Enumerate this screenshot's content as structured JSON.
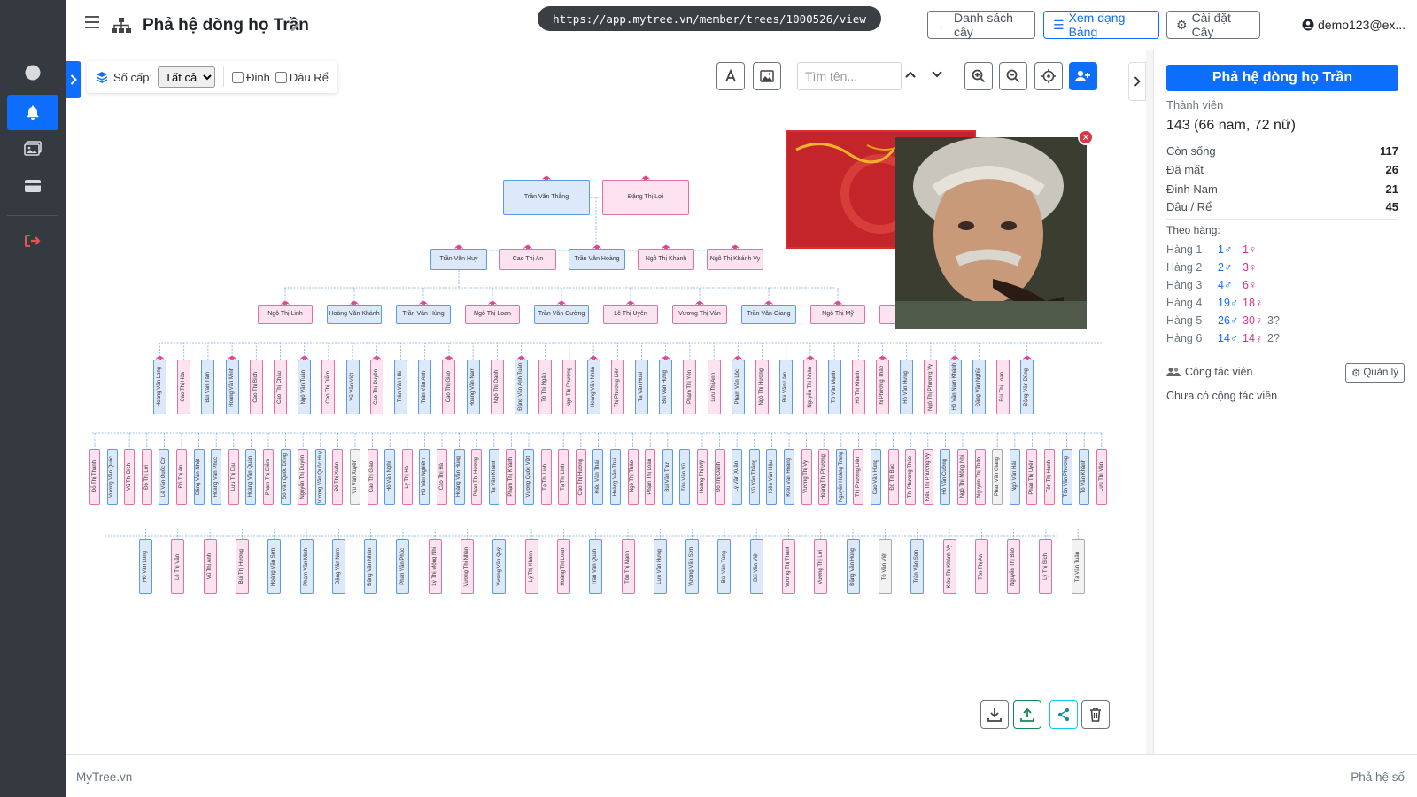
{
  "header": {
    "title": "Phả hệ dòng họ Trần",
    "url": "https://app.mytree.vn/member/trees/1000526/view",
    "btn_list": "Danh sách cây",
    "btn_table": "Xem dạng Bảng",
    "btn_settings": "Cài đặt Cây",
    "user": "demo123@ex..."
  },
  "toolbar": {
    "level_label": "Số cấp:",
    "level_value": "Tất cả",
    "chk_dinh": "Đinh",
    "chk_dau_re": "Dâu Rể",
    "search_placeholder": "Tìm tên..."
  },
  "icons": {
    "sidebar": [
      "circle-icon",
      "bell-icon",
      "images-icon",
      "card-icon",
      "logout-icon"
    ],
    "tools": [
      "font-icon",
      "image-icon",
      "zoom-in-icon",
      "zoom-out-icon",
      "locate-icon",
      "add-user-icon"
    ],
    "actions": [
      "download-icon",
      "upload-icon",
      "share-icon",
      "trash-icon"
    ]
  },
  "colors": {
    "primary": "#0d6efd",
    "male": "#dbe9fb",
    "female": "#fde3ef",
    "sidebar": "#343a40",
    "danger": "#dc3545"
  },
  "tree": {
    "gen1": [
      {
        "name": "Trần Văn Thắng",
        "g": "m"
      },
      {
        "name": "Đặng Thị Lợi",
        "g": "f"
      }
    ],
    "gen2": [
      {
        "name": "Trần Văn Huy",
        "g": "m"
      },
      {
        "name": "Cao Thị An",
        "g": "f"
      },
      {
        "name": "Trần Văn Hoàng",
        "g": "m"
      },
      {
        "name": "Ngô Thị Khánh",
        "g": "f"
      },
      {
        "name": "Ngô Thị Khánh Vy",
        "g": "f"
      }
    ],
    "gen3": [
      {
        "name": "Ngô Thị Linh",
        "g": "f"
      },
      {
        "name": "Hoàng Văn Khánh",
        "g": "m"
      },
      {
        "name": "Trần Văn Hùng",
        "g": "m"
      },
      {
        "name": "Ngô Thị Loan",
        "g": "f"
      },
      {
        "name": "Trần Văn Cường",
        "g": "m"
      },
      {
        "name": "Lê Thị Uyên",
        "g": "f"
      },
      {
        "name": "Vương Thị Vân",
        "g": "f"
      },
      {
        "name": "Trần Văn Giang",
        "g": "m"
      },
      {
        "name": "Ngô Thị Mỹ",
        "g": "f"
      },
      {
        "name": "",
        "g": "f"
      }
    ],
    "gen4": [
      {
        "name": "Hoàng Văn Long",
        "g": "m"
      },
      {
        "name": "Cao Thị Hòa",
        "g": "f"
      },
      {
        "name": "Bùi Văn Tâm",
        "g": "m"
      },
      {
        "name": "Hoàng Văn Minh",
        "g": "m"
      },
      {
        "name": "Cao Thị Bích",
        "g": "f"
      },
      {
        "name": "Cao Thị Châu",
        "g": "f"
      },
      {
        "name": "Ngô Văn Tuấn",
        "g": "m"
      },
      {
        "name": "Cao Thị Diễm",
        "g": "f"
      },
      {
        "name": "Vũ Văn Việt",
        "g": "m"
      },
      {
        "name": "Cao Thị Duyên",
        "g": "f"
      },
      {
        "name": "Trần Văn Hải",
        "g": "m"
      },
      {
        "name": "Trần Văn Anh",
        "g": "m"
      },
      {
        "name": "Cao Thị Giao",
        "g": "f"
      },
      {
        "name": "Hoàng Văn Nam",
        "g": "m"
      },
      {
        "name": "Ngô Thị Oanh",
        "g": "f"
      },
      {
        "name": "Đặng Văn Anh Tuấn",
        "g": "m"
      },
      {
        "name": "Tô Thị Ngân",
        "g": "f"
      },
      {
        "name": "Ngô Thị Phượng",
        "g": "f"
      },
      {
        "name": "Hoàng Văn Nhân",
        "g": "m"
      },
      {
        "name": "Thị Phương Liên",
        "g": "f"
      },
      {
        "name": "Tạ Văn Hoài",
        "g": "m"
      },
      {
        "name": "Bùi Văn Hưng",
        "g": "m"
      },
      {
        "name": "Phạm Thị Yến",
        "g": "f"
      },
      {
        "name": "Lưu Thị Anh",
        "g": "f"
      },
      {
        "name": "Phạm Văn Lộc",
        "g": "m"
      },
      {
        "name": "Ngô Thị Hương",
        "g": "f"
      },
      {
        "name": "Bùi Văn Lâm",
        "g": "m"
      },
      {
        "name": "Nguyễn Thị Nhàn",
        "g": "f"
      },
      {
        "name": "Tô Văn Mạnh",
        "g": "m"
      },
      {
        "name": "Hồ Thị Khánh",
        "g": "f"
      },
      {
        "name": "Thị Phương Thảo",
        "g": "f"
      },
      {
        "name": "Hồ Văn Hưng",
        "g": "m"
      },
      {
        "name": "Ngô Thị Phương Vy",
        "g": "f"
      },
      {
        "name": "Hồ Văn Nam Khánh",
        "g": "m"
      },
      {
        "name": "Đặng Văn Nghĩa",
        "g": "m"
      },
      {
        "name": "Bùi Thị Loan",
        "g": "f"
      },
      {
        "name": "Đặng Văn Dũng",
        "g": "m"
      }
    ],
    "gen5": [
      {
        "name": "Đỗ Thị Thanh",
        "g": "f"
      },
      {
        "name": "Vương Văn Quốc",
        "g": "m"
      },
      {
        "name": "Vũ Thị Bích",
        "g": "f"
      },
      {
        "name": "Đỗ Thị Lợi",
        "g": "f"
      },
      {
        "name": "Lê Văn Quốc Cơ",
        "g": "m"
      },
      {
        "name": "Đỗ Thị An",
        "g": "f"
      },
      {
        "name": "Đặng Văn Nhật",
        "g": "m"
      },
      {
        "name": "Hoàng Văn Phúc",
        "g": "m"
      },
      {
        "name": "Lưu Thị Dịu",
        "g": "f"
      },
      {
        "name": "Hoàng Văn Quân",
        "g": "m"
      },
      {
        "name": "Phạm Thị Diễm",
        "g": "f"
      },
      {
        "name": "Đỗ Văn Quốc Dũng",
        "g": "m"
      },
      {
        "name": "Nguyễn Thị Duyên",
        "g": "f"
      },
      {
        "name": "Vương Văn Quốc Huy",
        "g": "m"
      },
      {
        "name": "Đỗ Thị Xuân",
        "g": "f"
      },
      {
        "name": "Vũ Văn Xuyên",
        "g": "d"
      },
      {
        "name": "Cao Thị Giao",
        "g": "f"
      },
      {
        "name": "Hồ Văn Nghị",
        "g": "m"
      },
      {
        "name": "Lý Thị Hà",
        "g": "f"
      },
      {
        "name": "Hồ Văn Nghiêm",
        "g": "m"
      },
      {
        "name": "Cao Thị Hà",
        "g": "f"
      },
      {
        "name": "Hoàng Văn Hùng",
        "g": "m"
      },
      {
        "name": "Phan Thị Hương",
        "g": "f"
      },
      {
        "name": "Tạ Văn Khánh",
        "g": "m"
      },
      {
        "name": "Phạm Thị Khánh",
        "g": "f"
      },
      {
        "name": "Vương Quốc Việt",
        "g": "m"
      },
      {
        "name": "Tạ Thị Linh",
        "g": "f"
      },
      {
        "name": "Tạ Thị Linh",
        "g": "f"
      },
      {
        "name": "Cao Thị Hương",
        "g": "f"
      },
      {
        "name": "Kiều Văn Thái",
        "g": "m"
      },
      {
        "name": "Hoàng Văn Thái",
        "g": "m"
      },
      {
        "name": "Ngô Thị Thảo",
        "g": "f"
      },
      {
        "name": "Phạm Thị Loan",
        "g": "f"
      },
      {
        "name": "Bùi Văn Thư",
        "g": "m"
      },
      {
        "name": "Tôn Văn Vũ",
        "g": "m"
      },
      {
        "name": "Hoàng Thị Mỹ",
        "g": "f"
      },
      {
        "name": "Đỗ Thị Oanh",
        "g": "f"
      },
      {
        "name": "Lý Văn Xuân",
        "g": "m"
      },
      {
        "name": "Vũ Văn Thắng",
        "g": "m"
      },
      {
        "name": "Kiều Văn Hậu",
        "g": "m"
      },
      {
        "name": "Kiều Văn Hoàng",
        "g": "m"
      },
      {
        "name": "Vương Thị Vy",
        "g": "f"
      },
      {
        "name": "Hoàng Thị Phượng",
        "g": "f"
      },
      {
        "name": "Nguyễn Hoàng Trang",
        "g": "m"
      },
      {
        "name": "Thị Phương Liên",
        "g": "f"
      },
      {
        "name": "Cao Văn Hùng",
        "g": "m"
      },
      {
        "name": "Đỗ Thị Bắc",
        "g": "f"
      },
      {
        "name": "Thị Phương Thảo",
        "g": "f"
      },
      {
        "name": "Kiều Thị Phương Vy",
        "g": "f"
      },
      {
        "name": "Hồ Văn Cường",
        "g": "m"
      },
      {
        "name": "Ngô Thị Mộng Nhi",
        "g": "f"
      },
      {
        "name": "Nguyễn Thị Thảo",
        "g": "f"
      },
      {
        "name": "Phan Văn Giang",
        "g": "d"
      },
      {
        "name": "Ngô Văn Hải",
        "g": "m"
      },
      {
        "name": "Phan Thị Uyên",
        "g": "f"
      },
      {
        "name": "Tôn Thị Hạnh",
        "g": "f"
      },
      {
        "name": "Tôn Văn Phương",
        "g": "m"
      },
      {
        "name": "Tô Văn Khánh",
        "g": "m"
      },
      {
        "name": "Lưu Thị Vân",
        "g": "f"
      }
    ],
    "gen6": [
      {
        "name": "Hồ Văn Long",
        "g": "m"
      },
      {
        "name": "Lê Thị Văn",
        "g": "f"
      },
      {
        "name": "Vũ Thị Anh",
        "g": "f"
      },
      {
        "name": "Bùi Thị Hương",
        "g": "f"
      },
      {
        "name": "Hoàng Văn Sơn",
        "g": "m"
      },
      {
        "name": "Phạm Văn Minh",
        "g": "m"
      },
      {
        "name": "Đặng Văn Nam",
        "g": "m"
      },
      {
        "name": "Đặng Văn Nhân",
        "g": "m"
      },
      {
        "name": "Phan Văn Phúc",
        "g": "m"
      },
      {
        "name": "Lý Thị Mộng Nhi",
        "g": "f"
      },
      {
        "name": "Vương Thị Nhàn",
        "g": "f"
      },
      {
        "name": "Vương Văn Quý",
        "g": "m"
      },
      {
        "name": "Lý Thị Khánh",
        "g": "f"
      },
      {
        "name": "Hoàng Thị Loan",
        "g": "f"
      },
      {
        "name": "Trần Văn Quân",
        "g": "m"
      },
      {
        "name": "Tôn Thị Mạnh",
        "g": "f"
      },
      {
        "name": "Lưu Văn Hưng",
        "g": "m"
      },
      {
        "name": "Vương Văn Sơn",
        "g": "m"
      },
      {
        "name": "Bùi Văn Tùng",
        "g": "m"
      },
      {
        "name": "Bùi Văn Việt",
        "g": "m"
      },
      {
        "name": "Vương Thị Thanh",
        "g": "f"
      },
      {
        "name": "Vương Thị Lợi",
        "g": "f"
      },
      {
        "name": "Đặng Văn Hùng",
        "g": "m"
      },
      {
        "name": "Tô Văn Việt",
        "g": "d"
      },
      {
        "name": "Trần Văn Sơn",
        "g": "m"
      },
      {
        "name": "Kiều Thị Khánh Vy",
        "g": "f"
      },
      {
        "name": "Tôn Thị An",
        "g": "f"
      },
      {
        "name": "Nguyễn Thị Bảo",
        "g": "f"
      },
      {
        "name": "Lý Thị Bích",
        "g": "f"
      },
      {
        "name": "Tạ Văn Tuấn",
        "g": "d"
      }
    ]
  },
  "panel": {
    "title": "Phả hệ dòng họ Trần",
    "members_label": "Thành viên",
    "members_total": "143 (66 nam, 72 nữ)",
    "stats": [
      {
        "label": "Còn sống",
        "value": "117"
      },
      {
        "label": "Đã mất",
        "value": "26"
      },
      {
        "label": "Đinh Nam",
        "value": "21"
      },
      {
        "label": "Dâu / Rể",
        "value": "45"
      }
    ],
    "by_gen_label": "Theo hàng:",
    "gens": [
      {
        "label": "Hàng 1",
        "m": "1♂",
        "f": "1♀",
        "u": ""
      },
      {
        "label": "Hàng 2",
        "m": "2♂",
        "f": "3♀",
        "u": ""
      },
      {
        "label": "Hàng 3",
        "m": "4♂",
        "f": "6♀",
        "u": ""
      },
      {
        "label": "Hàng 4",
        "m": "19♂",
        "f": "18♀",
        "u": ""
      },
      {
        "label": "Hàng 5",
        "m": "26♂",
        "f": "30♀",
        "u": "3?"
      },
      {
        "label": "Hàng 6",
        "m": "14♂",
        "f": "14♀",
        "u": "2?"
      }
    ],
    "collab_label": "Cộng tác viên",
    "manage_btn": "Quản lý",
    "no_collab": "Chưa có cộng tác viên"
  },
  "footer": {
    "left": "MyTree.vn",
    "right": "Phả hệ số"
  }
}
